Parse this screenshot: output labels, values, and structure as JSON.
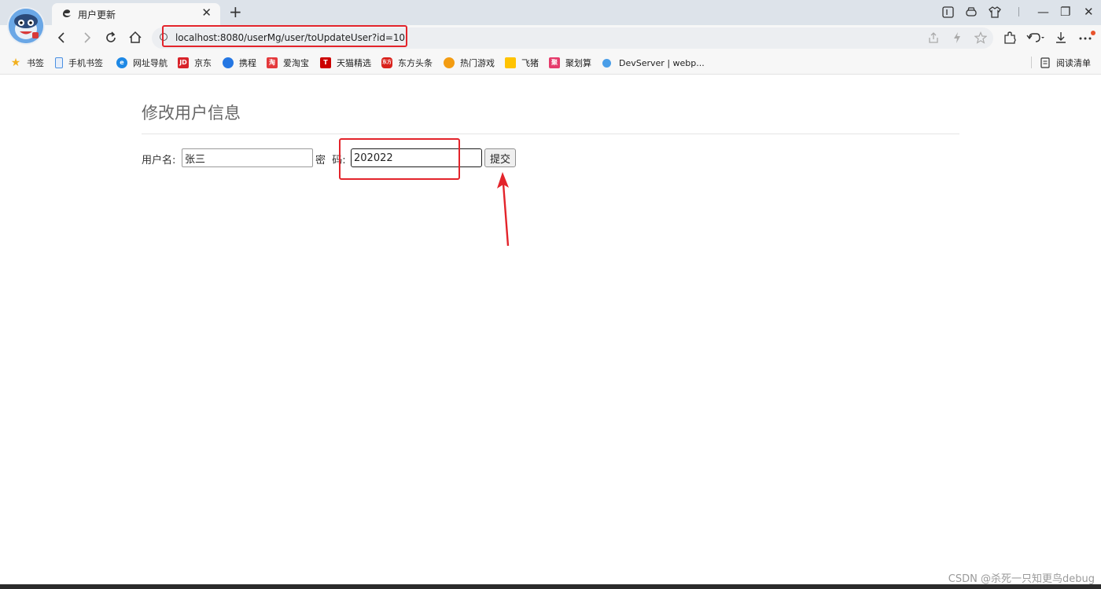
{
  "tab": {
    "title": "用户更新",
    "close_glyph": "✕",
    "new_tab_glyph": "+"
  },
  "window_controls": {
    "minimize": "—",
    "restore": "❐",
    "close": "✕"
  },
  "address_bar": {
    "url": "localhost:8080/userMg/user/toUpdateUser?id=10"
  },
  "bookmarks": [
    {
      "label": "书签",
      "icon": "star-icon",
      "color": "#f2b01e"
    },
    {
      "label": "手机书签",
      "icon": "phone-icon",
      "color": "#4a90e2"
    },
    {
      "label": "网址导航",
      "icon": "edge-icon",
      "color": "#1e88e5"
    },
    {
      "label": "京东",
      "icon": "jd-icon",
      "color": "#d8232a"
    },
    {
      "label": "携程",
      "icon": "ctrip-icon",
      "color": "#2577e3"
    },
    {
      "label": "爱淘宝",
      "icon": "taobao-icon",
      "color": "#e4393c"
    },
    {
      "label": "天猫精选",
      "icon": "tmall-icon",
      "color": "#cc0000"
    },
    {
      "label": "东方头条",
      "icon": "dongfang-icon",
      "color": "#d9221c"
    },
    {
      "label": "热门游戏",
      "icon": "game-icon",
      "color": "#f39c12"
    },
    {
      "label": "飞猪",
      "icon": "fliggy-icon",
      "color": "#ffc300"
    },
    {
      "label": "聚划算",
      "icon": "juhuasuan-icon",
      "color": "#e53b6b"
    },
    {
      "label": "DevServer | webp...",
      "icon": "devserver-icon",
      "color": "#4a9ee8"
    }
  ],
  "reading_list": {
    "label": "阅读清单"
  },
  "page": {
    "title": "修改用户信息",
    "username_label": "用户名:",
    "username_value": "张三",
    "password_label": "密  码:",
    "password_value": "202022",
    "submit_label": "提交"
  },
  "annotation_color": "#e3242b",
  "watermark": "CSDN @杀死一只知更鸟debug"
}
